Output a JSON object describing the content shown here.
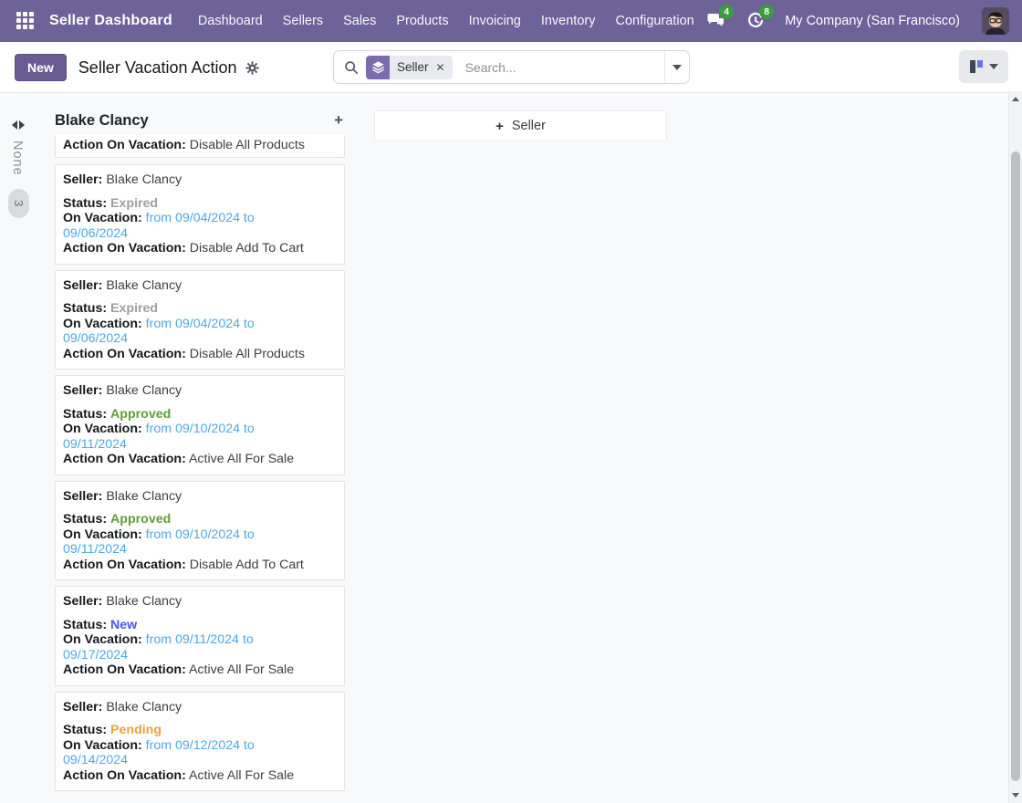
{
  "topbar": {
    "app_title": "Seller Dashboard",
    "menu_items": [
      "Dashboard",
      "Sellers",
      "Sales",
      "Products",
      "Invoicing",
      "Inventory",
      "Configuration"
    ],
    "messages_badge": "4",
    "activities_badge": "8",
    "company_name": "My Company (San Francisco)"
  },
  "control_panel": {
    "new_button_label": "New",
    "page_title": "Seller Vacation Action",
    "search_facet_value": "Seller",
    "search_placeholder": "Search..."
  },
  "icons": {
    "plus": "+",
    "close": "✕"
  },
  "kanban": {
    "collapsed_column": {
      "label": "None",
      "count": "3"
    },
    "column_title": "Blake Clancy",
    "card_labels": {
      "seller": "Seller:",
      "status": "Status:",
      "vacation": "On Vacation:",
      "action": "Action On Vacation:"
    },
    "partial_card": {
      "action_value": "Disable All Products"
    },
    "cards": [
      {
        "seller": "Blake Clancy",
        "status": "Expired",
        "status_key": "expired",
        "vacation": "from 09/04/2024 to 09/06/2024",
        "action": "Disable Add To Cart"
      },
      {
        "seller": "Blake Clancy",
        "status": "Expired",
        "status_key": "expired",
        "vacation": "from 09/04/2024 to 09/06/2024",
        "action": "Disable All Products"
      },
      {
        "seller": "Blake Clancy",
        "status": "Approved",
        "status_key": "approved",
        "vacation": "from 09/10/2024 to 09/11/2024",
        "action": "Active All For Sale"
      },
      {
        "seller": "Blake Clancy",
        "status": "Approved",
        "status_key": "approved",
        "vacation": "from 09/10/2024 to 09/11/2024",
        "action": "Disable Add To Cart"
      },
      {
        "seller": "Blake Clancy",
        "status": "New",
        "status_key": "new",
        "vacation": "from 09/11/2024 to 09/17/2024",
        "action": "Active All For Sale"
      },
      {
        "seller": "Blake Clancy",
        "status": "Pending",
        "status_key": "pending",
        "vacation": "from 09/12/2024 to 09/14/2024",
        "action": "Active All For Sale"
      }
    ],
    "add_column_label": "Seller"
  },
  "colors": {
    "topbar_bg": "#6d6398",
    "primary_button": "#6a5a92",
    "facet_icon_bg": "#7b6caf",
    "badge_green": "#3a9d3f",
    "status_expired": "#9e9ea4",
    "status_approved": "#5f9e33",
    "status_new": "#4a54f1",
    "status_pending": "#eaa43b",
    "date_link": "#4da7e8"
  }
}
